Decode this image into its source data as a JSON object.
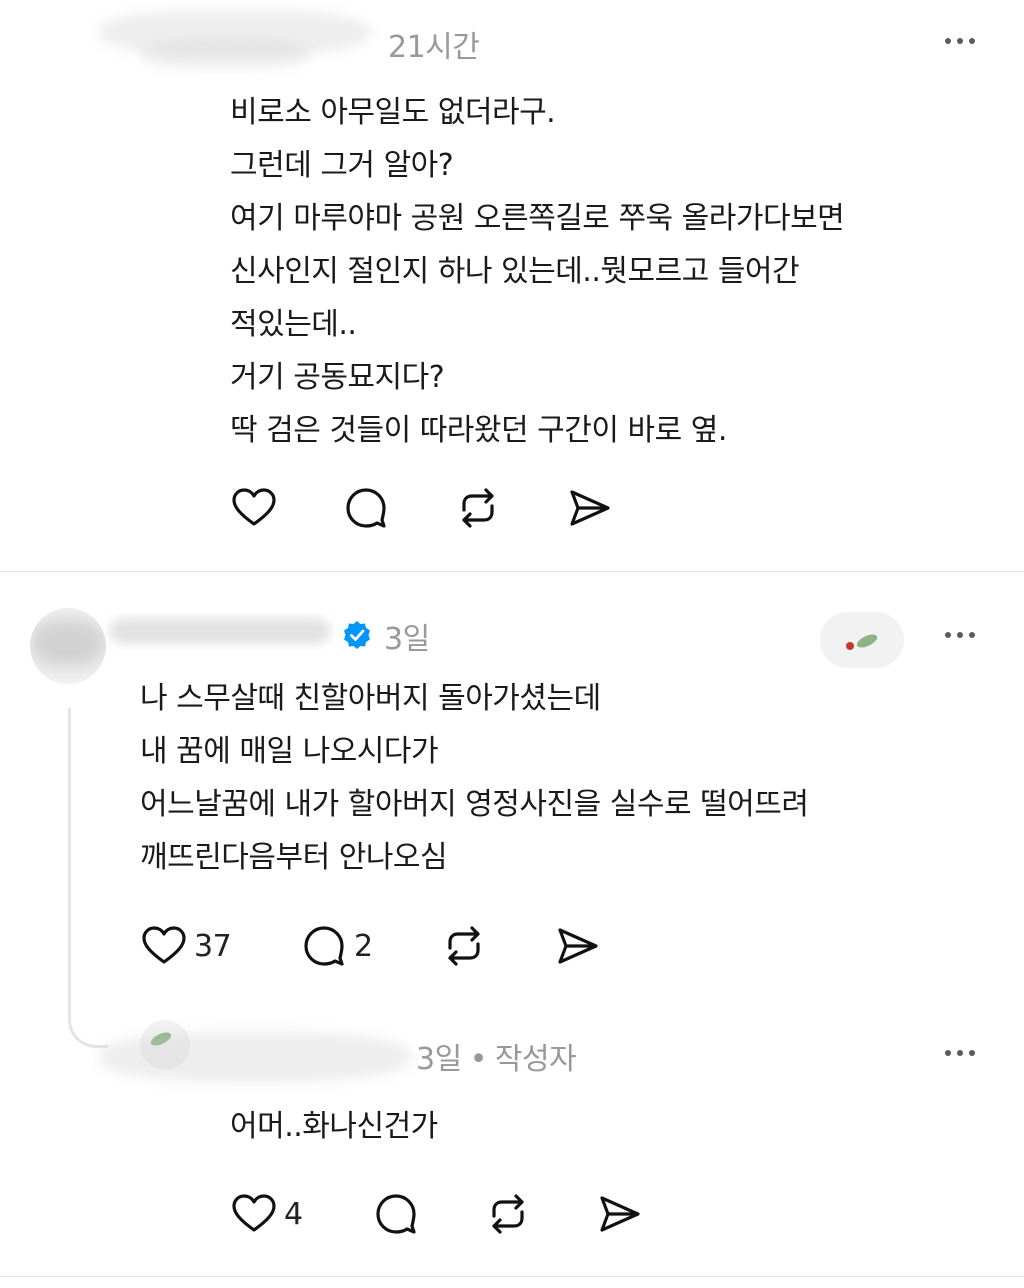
{
  "post1": {
    "time": "21시간",
    "lines": [
      "비로소 아무일도 없더라구.",
      "그런데 그거 알아?",
      "여기 마루야마 공원 오른쪽길로 쭈욱 올라가다보면",
      "신사인지 절인지 하나 있는데..뭣모르고 들어간",
      "적있는데..",
      "거기 공동묘지다?",
      "딱 검은 것들이 따라왔던 구간이 바로 옆."
    ]
  },
  "post2": {
    "time": "3일",
    "verified": true,
    "lines": [
      "나 스무살때 친할아버지 돌아가셨는데",
      "내 꿈에 매일 나오시다가",
      "어느날꿈에 내가 할아버지 영정사진을 실수로 떨어뜨려",
      "깨뜨린다음부터 안나오심"
    ],
    "like_count": "37",
    "reply_count": "2"
  },
  "post3": {
    "time": "3일",
    "separator": "•",
    "author_tag": "작성자",
    "lines": [
      "어머..화나신건가"
    ],
    "like_count": "4"
  },
  "icons": {
    "like": "heart-icon",
    "reply": "comment-icon",
    "repost": "repost-icon",
    "share": "send-icon",
    "more": "more-dots-icon",
    "verified": "verified-badge-icon"
  },
  "colors": {
    "verified": "#0095f6",
    "meta": "#999999",
    "text": "#1a1a1a"
  }
}
